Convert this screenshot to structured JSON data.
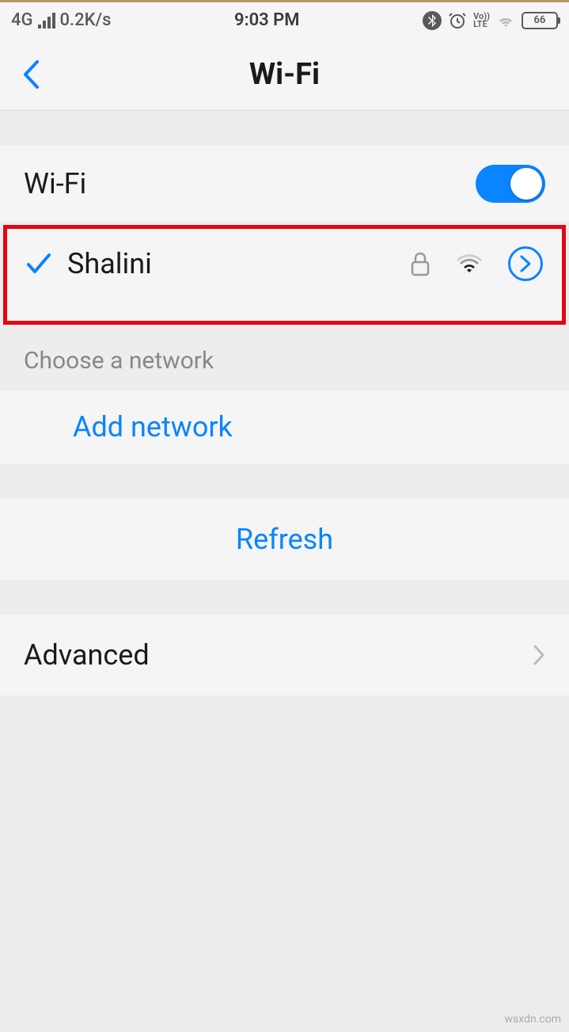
{
  "status": {
    "network_type": "4G",
    "data_rate": "0.2K/s",
    "time": "9:03 PM",
    "volte_top": "Vo))",
    "volte_bottom": "LTE",
    "battery": "66"
  },
  "nav": {
    "title": "Wi-Fi"
  },
  "wifi_toggle": {
    "label": "Wi-Fi",
    "enabled": true
  },
  "connected_network": {
    "name": "Shalini",
    "secured": true,
    "connected": true
  },
  "sections": {
    "choose_header": "Choose a network",
    "add_network": "Add network",
    "refresh": "Refresh",
    "advanced": "Advanced"
  },
  "watermark": "wsxdn.com"
}
